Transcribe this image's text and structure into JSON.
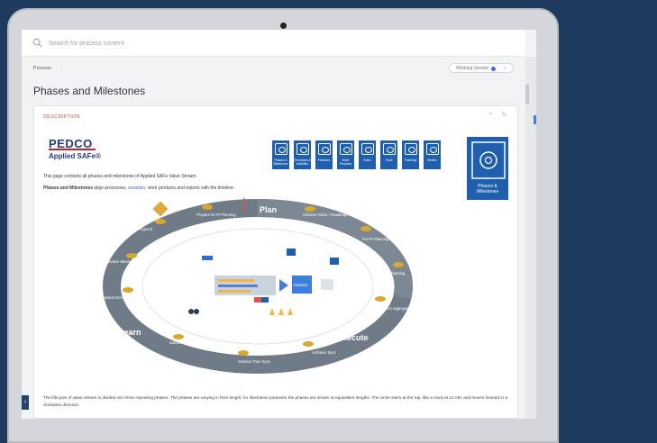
{
  "search": {
    "placeholder": "Search for process content"
  },
  "breadcrumb": "Process",
  "version": {
    "label": "Working Version",
    "status_color": "#3a6fd8"
  },
  "page_title": "Phases and Milestones",
  "card": {
    "section_label": "DESCRIPTION",
    "logo_text": "PEDCO",
    "logo_sub": "Applied SAFe®",
    "intro": "This page contains all phases and milestones of Applied SAFe Value Stream.",
    "lead_bold": "Phases and Milestones",
    "lead_text1": " align processes, ",
    "lead_link": "activities",
    "lead_text2": ", work products and reports with the timeline.",
    "icon_tiles": [
      {
        "label": "Phases & Milestones",
        "icon": "phases-icon"
      },
      {
        "label": "Processes & Activities",
        "icon": "processes-icon"
      },
      {
        "label": "Practices",
        "icon": "practices-icon"
      },
      {
        "label": "Work Products",
        "icon": "work-products-icon"
      },
      {
        "label": "Roles",
        "icon": "roles-icon"
      },
      {
        "label": "Tools",
        "icon": "tools-icon"
      },
      {
        "label": "Trainings",
        "icon": "trainings-icon"
      },
      {
        "label": "Metrics",
        "icon": "metrics-icon"
      }
    ],
    "big_tile_label": "Phases & Milestones",
    "wheel": {
      "phases": [
        "Plan",
        "Execute",
        "Learn"
      ],
      "milestones": [
        "Prepare for PI Planning",
        "Solution Vision / Roadmap Readiness",
        "Pre-PI Planning",
        "Post-PI Planning",
        "PI Objectives Aggregated",
        "Architect Sync",
        "Solution Train Sync",
        "Solution Integrated",
        "Solution Demo",
        "Quantitative Measures Ready",
        "Adaptions Agreed"
      ],
      "center": "Solution"
    },
    "footer_text": "The lifecycle of value stream is divided into three repeating phases. The phases are varying in their length; for illustration purposes the phases are shown at equivalent lengths. The circle starts at the top, like a clock at 12 AM, and moves forward in a clockwise direction."
  },
  "colors": {
    "background": "#1f3a5f",
    "accent": "#1f5fae",
    "ring": "#6f7b87"
  }
}
